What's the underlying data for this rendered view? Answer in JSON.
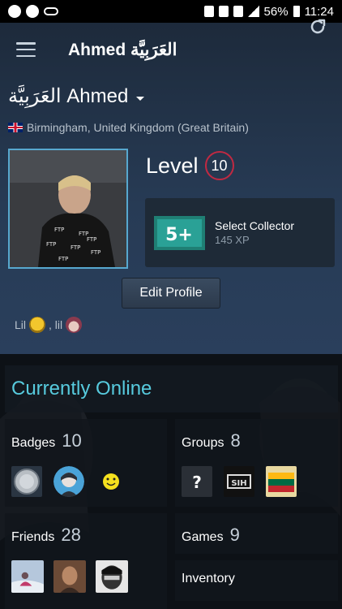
{
  "status_bar": {
    "battery": "56%",
    "time": "11:24"
  },
  "app_bar": {
    "title": "Ahmed العَرَبِيَّة"
  },
  "profile": {
    "persona_name": "العَرَبِيَّة Ahmed",
    "location": "Birmingham, United Kingdom (Great Britain)",
    "level_label": "Level",
    "level": "10",
    "featured_badge": {
      "name": "Select Collector",
      "xp": "145 XP",
      "icon_text": "5+"
    },
    "edit_button": "Edit Profile",
    "status_part1": "Lil",
    "status_part2": ", lil"
  },
  "online_status": "Currently Online",
  "sections": {
    "badges": {
      "label": "Badges",
      "count": "10"
    },
    "groups": {
      "label": "Groups",
      "count": "8"
    },
    "friends": {
      "label": "Friends",
      "count": "28"
    },
    "games": {
      "label": "Games",
      "count": "9"
    },
    "inventory": {
      "label": "Inventory"
    }
  },
  "colors": {
    "accent_online": "#57cbde",
    "level_ring": "#c02942",
    "avatar_border": "#57a8cf"
  }
}
